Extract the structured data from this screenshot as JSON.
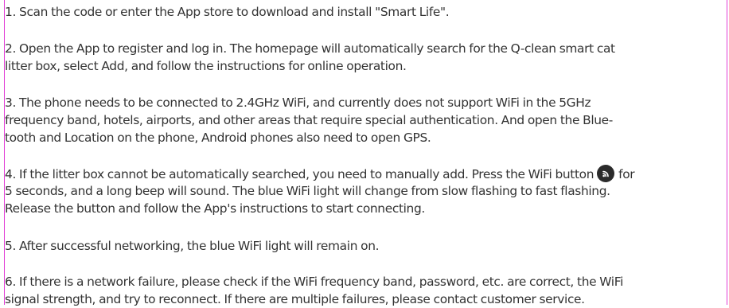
{
  "colors": {
    "frame": "#e23bd6",
    "text": "#333333",
    "icon_bg": "#2b2b2b"
  },
  "instructions": {
    "step1": {
      "line1": "1. Scan the code or enter the App store to download and install \"Smart Life\"."
    },
    "step2": {
      "line1": "2. Open the App to register and log in. The homepage will automatically search for the Q-clean smart cat",
      "line2": "litter box, select Add, and follow the instructions for online operation."
    },
    "step3": {
      "line1": "3. The phone needs to be connected to 2.4GHz WiFi, and currently does not support WiFi in the 5GHz",
      "line2": "frequency band, hotels, airports, and other areas that require special authentication. And open the Blue-",
      "line3": "tooth and Location on the phone, Android phones also need to open GPS."
    },
    "step4": {
      "line1_before_icon": "4. If the litter box cannot be automatically searched, you need to manually add. Press the WiFi button",
      "line1_after_icon": "for",
      "line2": "5 seconds, and a long beep will sound. The blue WiFi light will change from slow flashing to fast flashing.",
      "line3": "Release the button and follow the App's instructions to start connecting.",
      "icon": "wifi-button-icon"
    },
    "step5": {
      "line1": "5. After successful networking, the blue WiFi light will remain on."
    },
    "step6": {
      "line1": "6. If there is a network failure, please check if the WiFi frequency band, password, etc. are correct, the WiFi",
      "line2": "signal strength, and try to reconnect. If there are multiple failures, please contact customer service."
    }
  }
}
